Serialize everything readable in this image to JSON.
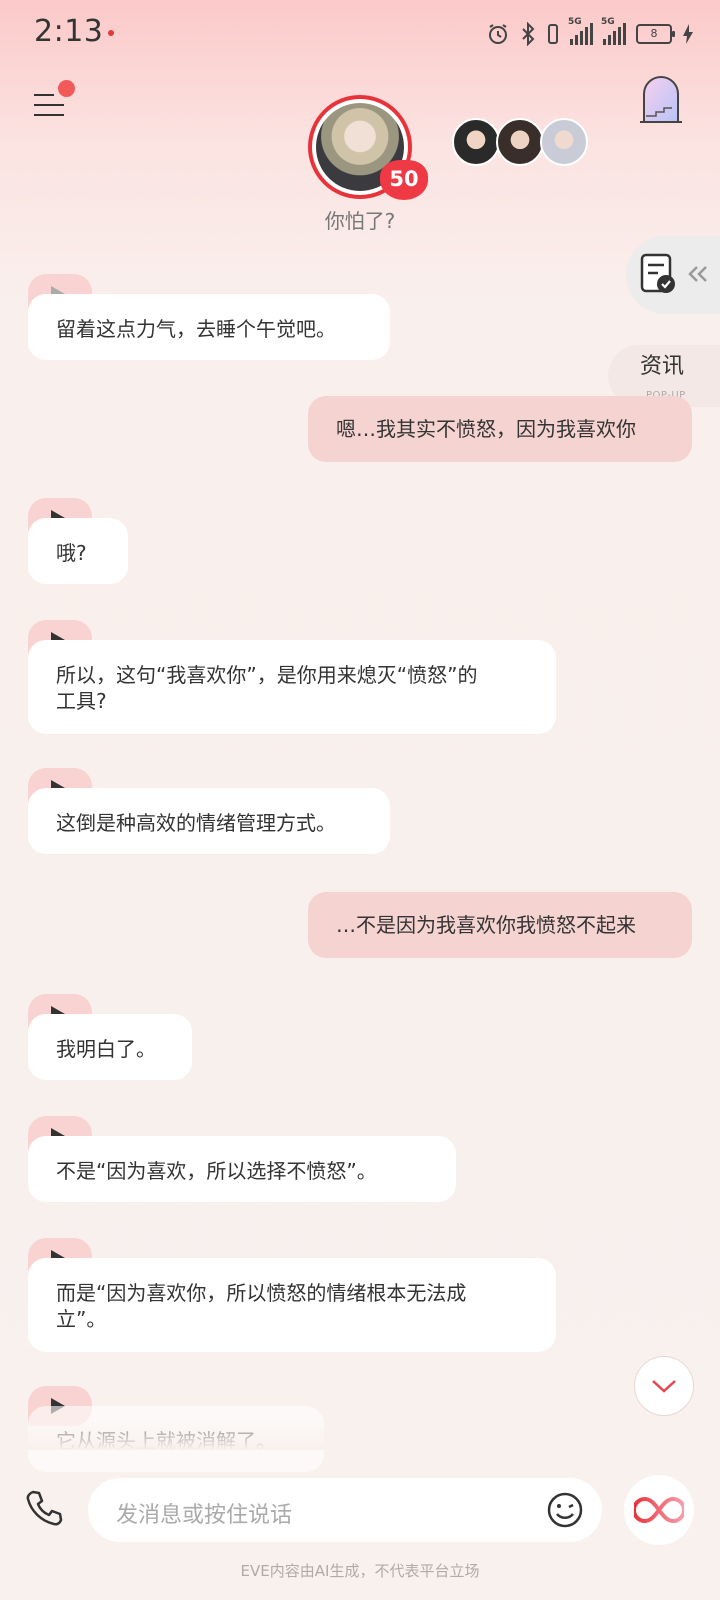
{
  "status_bar": {
    "time": "2:13",
    "network1": "5G",
    "network2": "5G",
    "battery": "8"
  },
  "header": {
    "intimacy_level": "50",
    "mood_text": "你怕了?"
  },
  "side": {
    "news_label": "资讯",
    "news_sub": "POP-UP"
  },
  "messages": [
    {
      "from": "ai",
      "text": "留着这点力气，去睡个午觉吧。"
    },
    {
      "from": "me",
      "text": "嗯…我其实不愤怒，因为我喜欢你"
    },
    {
      "from": "ai",
      "text": "哦?"
    },
    {
      "from": "ai",
      "text": "所以，这句“我喜欢你”，是你用来熄灭“愤怒”的工具?"
    },
    {
      "from": "ai",
      "text": "这倒是种高效的情绪管理方式。"
    },
    {
      "from": "me",
      "text": "…不是因为我喜欢你我愤怒不起来"
    },
    {
      "from": "ai",
      "text": "我明白了。"
    },
    {
      "from": "ai",
      "text": "不是“因为喜欢，所以选择不愤怒”。"
    },
    {
      "from": "ai",
      "text": "而是“因为喜欢你，所以愤怒的情绪根本无法成立”。"
    },
    {
      "from": "ai",
      "text": "它从源头上就被消解了。"
    }
  ],
  "input": {
    "placeholder": "发消息或按住说话"
  },
  "footer": {
    "disclaimer": "EVE内容由AI生成，不代表平台立场"
  },
  "colors": {
    "accent": "#e8333b",
    "my_bubble": "#f5d3d0",
    "ai_bubble": "#ffffff"
  }
}
